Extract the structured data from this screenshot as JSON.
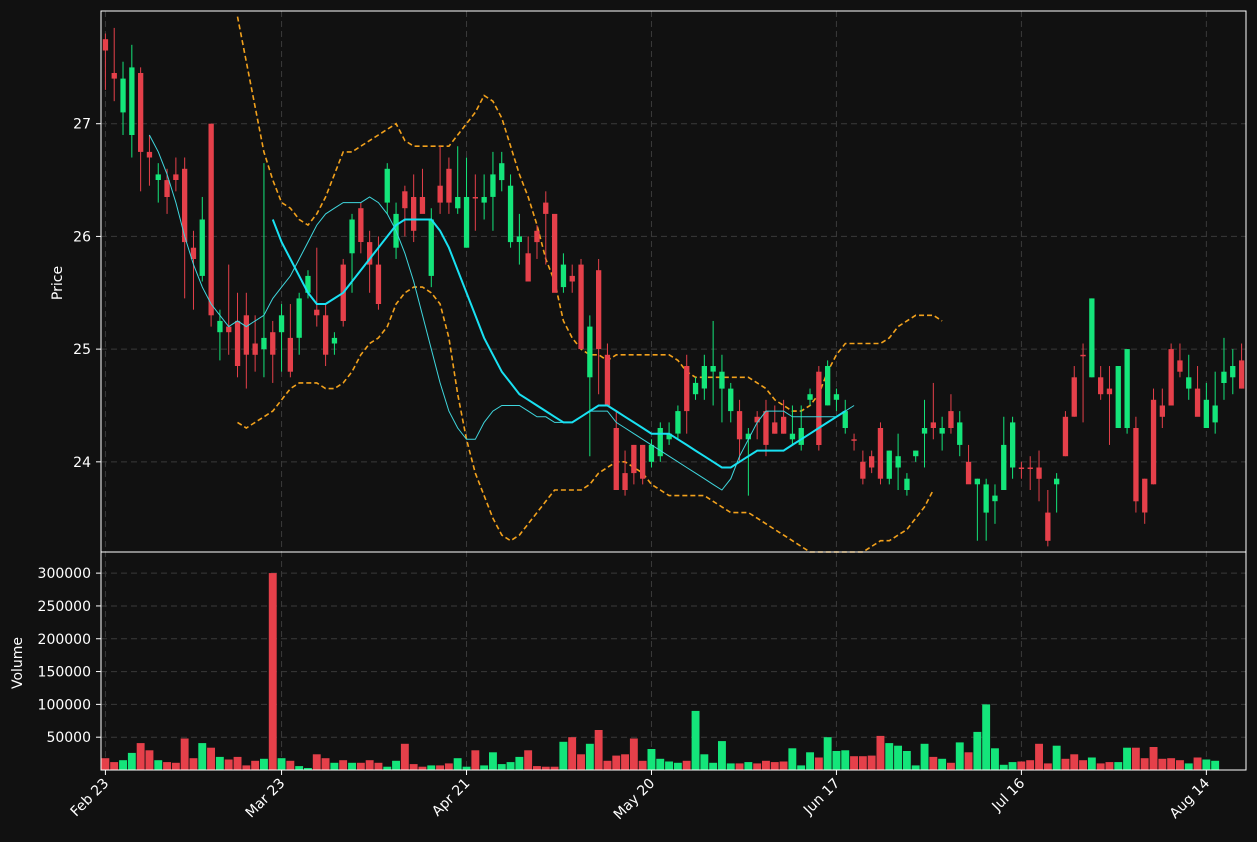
{
  "chart_data": {
    "type": "candlestick",
    "panels": [
      {
        "name": "price",
        "ylabel": "Price",
        "ylim": [
          23.2,
          28.0
        ],
        "yticks": [
          24,
          25,
          26,
          27
        ]
      },
      {
        "name": "volume",
        "ylabel": "Volume",
        "ylim": [
          0,
          320000
        ],
        "yticks": [
          50000,
          100000,
          150000,
          200000,
          250000,
          300000
        ]
      }
    ],
    "x_ticks": [
      {
        "label": "Feb 23",
        "index": 0
      },
      {
        "label": "Mar 23",
        "index": 20
      },
      {
        "label": "Apr 21",
        "index": 41
      },
      {
        "label": "May 20",
        "index": 62
      },
      {
        "label": "Jun 17",
        "index": 83
      },
      {
        "label": "Jul 16",
        "index": 104
      },
      {
        "label": "Aug 14",
        "index": 125
      }
    ],
    "colors": {
      "background": "#111111",
      "up": "#14e57a",
      "down": "#e5404a",
      "ma_fast": "#3fd6dd",
      "ma_slow": "#19e1f2",
      "band": "#f2a11c",
      "grid": "#3a3a3a",
      "axis": "#ffffff"
    },
    "up_sequence": "DDUUDDUDDDDUDUDDDDUDUDUUDDUDUDDDUUDDDUDDUUDUUUUUDDDDUDDUDDDDDDUUUUDUUUUUDUDDDDUUUDUUUDDDDUUUUUDUDUDUUUUUDDDDUDDDUDDUUDDDDDDUDUUUUDDDDUDD",
    "ohlc": [
      [
        27.65,
        27.8,
        27.3,
        27.75
      ],
      [
        27.45,
        27.85,
        27.2,
        27.4
      ],
      [
        27.1,
        27.55,
        26.9,
        27.4
      ],
      [
        26.9,
        27.7,
        26.7,
        27.5
      ],
      [
        26.75,
        27.5,
        26.4,
        27.45
      ],
      [
        26.75,
        26.9,
        26.45,
        26.7
      ],
      [
        26.5,
        26.65,
        26.3,
        26.55
      ],
      [
        26.35,
        26.6,
        26.2,
        26.5
      ],
      [
        26.5,
        26.7,
        26.4,
        26.55
      ],
      [
        25.95,
        26.7,
        25.45,
        26.6
      ],
      [
        25.8,
        26.05,
        25.35,
        25.9
      ],
      [
        26.15,
        26.35,
        25.6,
        25.65
      ],
      [
        25.3,
        27.0,
        25.2,
        27.0
      ],
      [
        25.15,
        25.35,
        24.9,
        25.25
      ],
      [
        25.15,
        25.75,
        24.95,
        25.2
      ],
      [
        25.25,
        25.5,
        24.75,
        24.85
      ],
      [
        24.95,
        25.5,
        24.65,
        25.3
      ],
      [
        25.05,
        25.3,
        24.8,
        24.95
      ],
      [
        25.1,
        26.65,
        24.75,
        25.0
      ],
      [
        24.95,
        25.25,
        24.7,
        25.15
      ],
      [
        25.15,
        25.4,
        24.8,
        25.3
      ],
      [
        24.8,
        25.4,
        24.75,
        25.1
      ],
      [
        25.1,
        25.5,
        24.95,
        25.45
      ],
      [
        25.65,
        25.7,
        25.45,
        25.5
      ],
      [
        25.3,
        25.9,
        25.2,
        25.35
      ],
      [
        25.3,
        25.4,
        24.85,
        24.95
      ],
      [
        25.05,
        25.15,
        24.95,
        25.1
      ],
      [
        25.75,
        25.8,
        25.2,
        25.25
      ],
      [
        26.15,
        26.2,
        25.5,
        25.85
      ],
      [
        25.95,
        26.3,
        25.85,
        26.25
      ],
      [
        25.75,
        26.05,
        25.5,
        25.95
      ],
      [
        25.4,
        26.0,
        25.35,
        25.75
      ],
      [
        26.3,
        26.65,
        26.2,
        26.6
      ],
      [
        25.9,
        26.3,
        25.8,
        26.2
      ],
      [
        26.25,
        26.45,
        26.0,
        26.4
      ],
      [
        26.05,
        26.55,
        25.95,
        26.35
      ],
      [
        26.35,
        26.6,
        26.25,
        26.2
      ],
      [
        25.65,
        26.25,
        25.55,
        26.15
      ],
      [
        26.3,
        26.8,
        26.2,
        26.45
      ],
      [
        26.6,
        26.7,
        26.2,
        26.3
      ],
      [
        26.25,
        26.8,
        26.2,
        26.35
      ],
      [
        25.9,
        26.7,
        25.9,
        26.35
      ],
      [
        26.35,
        26.55,
        26.05,
        26.35
      ],
      [
        26.3,
        26.55,
        26.15,
        26.35
      ],
      [
        26.55,
        26.75,
        26.05,
        26.35
      ],
      [
        26.5,
        26.75,
        26.4,
        26.65
      ],
      [
        26.45,
        26.55,
        25.9,
        25.95
      ],
      [
        26.0,
        26.2,
        25.75,
        25.95
      ],
      [
        25.85,
        26.0,
        25.65,
        25.6
      ],
      [
        26.05,
        26.1,
        25.8,
        25.95
      ],
      [
        26.3,
        26.4,
        25.75,
        26.2
      ],
      [
        26.2,
        26.1,
        25.75,
        25.5
      ],
      [
        25.75,
        25.85,
        25.5,
        25.55
      ],
      [
        25.65,
        25.75,
        25.5,
        25.6
      ],
      [
        25.75,
        25.8,
        25.0,
        25.0
      ],
      [
        25.2,
        25.3,
        24.05,
        24.75
      ],
      [
        25.7,
        25.8,
        24.6,
        25.0
      ],
      [
        24.95,
        25.05,
        24.5,
        24.5
      ],
      [
        24.3,
        24.45,
        23.75,
        23.75
      ],
      [
        23.75,
        24.1,
        23.7,
        23.9
      ],
      [
        23.9,
        24.15,
        23.8,
        24.15
      ],
      [
        23.85,
        24.15,
        23.8,
        24.15
      ],
      [
        24.15,
        24.2,
        23.95,
        24.0
      ],
      [
        24.05,
        24.35,
        24.0,
        24.3
      ],
      [
        24.2,
        24.35,
        24.15,
        24.25
      ],
      [
        24.25,
        24.5,
        24.2,
        24.45
      ],
      [
        24.45,
        24.95,
        24.25,
        24.85
      ],
      [
        24.6,
        24.75,
        24.55,
        24.7
      ],
      [
        24.65,
        24.95,
        24.55,
        24.85
      ],
      [
        24.85,
        25.25,
        24.5,
        24.8
      ],
      [
        24.8,
        24.95,
        24.35,
        24.65
      ],
      [
        24.65,
        24.7,
        24.35,
        24.45
      ],
      [
        24.45,
        24.55,
        24.0,
        24.2
      ],
      [
        24.25,
        24.3,
        23.7,
        24.2
      ],
      [
        24.35,
        24.45,
        24.2,
        24.4
      ],
      [
        24.45,
        24.55,
        24.05,
        24.15
      ],
      [
        24.35,
        24.5,
        24.25,
        24.25
      ],
      [
        24.4,
        24.55,
        24.25,
        24.25
      ],
      [
        24.25,
        24.5,
        24.15,
        24.2
      ],
      [
        24.15,
        24.5,
        24.1,
        24.3
      ],
      [
        24.55,
        24.65,
        24.5,
        24.6
      ],
      [
        24.15,
        24.85,
        24.1,
        24.8
      ],
      [
        24.85,
        24.9,
        24.5,
        24.5
      ],
      [
        24.55,
        24.65,
        24.45,
        24.6
      ],
      [
        24.45,
        24.55,
        24.25,
        24.3
      ],
      [
        24.2,
        24.25,
        24.1,
        24.2
      ],
      [
        24.0,
        24.1,
        23.8,
        23.85
      ],
      [
        23.95,
        24.1,
        23.9,
        24.05
      ],
      [
        24.3,
        24.35,
        23.8,
        23.85
      ],
      [
        23.85,
        24.1,
        23.8,
        24.1
      ],
      [
        23.95,
        24.25,
        23.75,
        24.05
      ],
      [
        23.75,
        23.9,
        23.7,
        23.85
      ],
      [
        24.05,
        24.1,
        24.0,
        24.1
      ],
      [
        24.3,
        24.55,
        23.95,
        24.25
      ],
      [
        24.35,
        24.7,
        24.2,
        24.3
      ],
      [
        24.25,
        24.4,
        24.1,
        24.3
      ],
      [
        24.45,
        24.6,
        24.25,
        24.3
      ],
      [
        24.35,
        24.45,
        24.05,
        24.15
      ],
      [
        24.0,
        24.15,
        23.85,
        23.8
      ],
      [
        23.85,
        23.85,
        23.3,
        23.8
      ],
      [
        23.8,
        23.85,
        23.3,
        23.55
      ],
      [
        23.65,
        23.8,
        23.45,
        23.7
      ],
      [
        24.15,
        24.4,
        23.8,
        23.75
      ],
      [
        24.35,
        24.4,
        23.85,
        23.95
      ],
      [
        23.95,
        24.0,
        23.85,
        23.95
      ],
      [
        23.95,
        24.05,
        23.75,
        23.95
      ],
      [
        23.95,
        24.1,
        23.65,
        23.85
      ],
      [
        23.55,
        23.75,
        23.25,
        23.3
      ],
      [
        23.8,
        23.9,
        23.55,
        23.85
      ],
      [
        24.4,
        24.45,
        24.05,
        24.05
      ],
      [
        24.75,
        24.85,
        24.4,
        24.4
      ],
      [
        24.95,
        25.05,
        24.35,
        24.95
      ],
      [
        25.45,
        25.45,
        24.75,
        24.75
      ],
      [
        24.75,
        24.85,
        24.55,
        24.6
      ],
      [
        24.65,
        24.85,
        24.15,
        24.6
      ],
      [
        24.85,
        24.85,
        24.3,
        24.3
      ],
      [
        25.0,
        25.0,
        24.25,
        24.3
      ],
      [
        24.3,
        24.4,
        23.55,
        23.65
      ],
      [
        23.55,
        23.85,
        23.45,
        23.85
      ],
      [
        24.55,
        24.65,
        23.8,
        23.8
      ],
      [
        24.4,
        24.65,
        24.3,
        24.5
      ],
      [
        24.5,
        25.05,
        24.5,
        25.0
      ],
      [
        24.9,
        25.05,
        24.75,
        24.8
      ],
      [
        24.75,
        24.95,
        24.55,
        24.65
      ],
      [
        24.65,
        24.85,
        24.45,
        24.4
      ],
      [
        24.55,
        24.7,
        24.35,
        24.3
      ],
      [
        24.5,
        24.8,
        24.25,
        24.35
      ],
      [
        24.8,
        25.1,
        24.55,
        24.7
      ],
      [
        24.75,
        25.0,
        24.6,
        24.85
      ],
      [
        24.9,
        25.05,
        24.65,
        24.65
      ]
    ],
    "volume": [
      18000,
      12000,
      15000,
      26000,
      41000,
      30000,
      15000,
      12000,
      11000,
      48000,
      18000,
      41000,
      34000,
      20000,
      16000,
      20000,
      7000,
      14000,
      17000,
      300000,
      18000,
      14000,
      6000,
      3000,
      24000,
      18000,
      11000,
      15000,
      11000,
      11000,
      15000,
      11000,
      5000,
      14000,
      40000,
      9000,
      5000,
      7000,
      7000,
      10000,
      18000,
      5000,
      30000,
      7000,
      27000,
      9000,
      12000,
      20000,
      30000,
      6000,
      5000,
      5000,
      43000,
      50000,
      24000,
      40000,
      61000,
      14000,
      22000,
      24000,
      48000,
      14000,
      32000,
      17000,
      13000,
      11000,
      14000,
      90000,
      24000,
      11000,
      44000,
      10000,
      10000,
      12000,
      10000,
      14000,
      12000,
      13000,
      33000,
      7000,
      27000,
      19000,
      50000,
      29000,
      30000,
      21000,
      21000,
      22000,
      52000,
      41000,
      37000,
      29000,
      7000,
      40000,
      20000,
      17000,
      11000,
      42000,
      27000,
      58000,
      100000,
      33000,
      8000,
      12000,
      13000,
      15000,
      40000,
      10000,
      37000,
      17000,
      24000,
      15000,
      19000,
      10000,
      12000,
      12000,
      34000,
      34000,
      18000,
      35000,
      17000,
      18000,
      15000,
      10000,
      19000,
      16000,
      14000
    ],
    "ma_fast": {
      "start": 5,
      "label": "",
      "values": [
        26.9,
        26.75,
        26.55,
        26.3,
        26.0,
        25.75,
        25.55,
        25.4,
        25.3,
        25.2,
        25.25,
        25.2,
        25.25,
        25.3,
        25.45,
        25.55,
        25.65,
        25.8,
        25.95,
        26.1,
        26.2,
        26.25,
        26.3,
        26.3,
        26.3,
        26.35,
        26.3,
        26.2,
        26.05,
        25.85,
        25.6,
        25.3,
        25.0,
        24.7,
        24.45,
        24.3,
        24.2,
        24.2,
        24.35,
        24.45,
        24.5,
        24.5,
        24.5,
        24.45,
        24.4,
        24.4,
        24.35,
        24.35,
        24.35,
        24.4,
        24.45,
        24.45,
        24.45,
        24.35,
        24.3,
        24.25,
        24.2,
        24.15,
        24.1,
        24.05,
        24.0,
        23.95,
        23.9,
        23.85,
        23.8,
        23.75,
        23.85,
        24.05,
        24.2,
        24.35,
        24.45,
        24.45,
        24.45,
        24.4,
        24.4,
        24.4,
        24.4,
        24.4,
        24.4,
        24.45,
        24.5
      ]
    },
    "ma_slow": {
      "start": 19,
      "label": "",
      "values": [
        26.15,
        25.95,
        25.8,
        25.65,
        25.5,
        25.4,
        25.4,
        25.45,
        25.5,
        25.6,
        25.7,
        25.8,
        25.9,
        26.0,
        26.1,
        26.15,
        26.15,
        26.15,
        26.15,
        26.05,
        25.9,
        25.7,
        25.5,
        25.3,
        25.1,
        24.95,
        24.8,
        24.7,
        24.6,
        24.55,
        24.5,
        24.45,
        24.4,
        24.35,
        24.35,
        24.4,
        24.45,
        24.5,
        24.5,
        24.45,
        24.4,
        24.35,
        24.3,
        24.25,
        24.25,
        24.25,
        24.2,
        24.15,
        24.1,
        24.05,
        24.0,
        23.95,
        23.95,
        24.0,
        24.05,
        24.1,
        24.1,
        24.1,
        24.1,
        24.15,
        24.2,
        24.25,
        24.3,
        24.35,
        24.4,
        24.45
      ]
    },
    "band_upper": [
      27.95,
      27.55,
      27.15,
      26.75,
      26.5,
      26.3,
      26.25,
      26.15,
      26.1,
      26.2,
      26.35,
      26.55,
      26.75,
      26.75,
      26.8,
      26.85,
      26.9,
      26.95,
      27.0,
      26.85,
      26.8,
      26.8,
      26.8,
      26.8,
      26.8,
      26.9,
      27.0,
      27.1,
      27.25,
      27.2,
      27.05,
      26.8,
      26.55,
      26.35,
      26.1,
      25.8,
      25.6,
      25.25,
      25.1,
      25.0,
      24.95,
      24.95,
      24.9,
      24.95,
      24.95,
      24.95,
      24.95,
      24.95,
      24.95,
      24.95,
      24.9,
      24.8,
      24.75,
      24.75,
      24.75,
      24.75,
      24.75,
      24.75,
      24.75,
      24.7,
      24.65,
      24.55,
      24.5,
      24.45,
      24.45,
      24.5,
      24.6,
      24.8,
      24.95,
      25.05,
      25.05,
      25.05,
      25.05,
      25.05,
      25.1,
      25.2,
      25.25,
      25.3,
      25.3,
      25.3,
      25.25
    ],
    "band_lower": [
      24.35,
      24.3,
      24.35,
      24.4,
      24.45,
      24.55,
      24.65,
      24.7,
      24.7,
      24.7,
      24.65,
      24.65,
      24.7,
      24.8,
      24.95,
      25.05,
      25.1,
      25.2,
      25.4,
      25.5,
      25.55,
      25.55,
      25.5,
      25.4,
      25.1,
      24.6,
      24.2,
      23.9,
      23.7,
      23.5,
      23.35,
      23.3,
      23.35,
      23.45,
      23.55,
      23.65,
      23.75,
      23.75,
      23.75,
      23.75,
      23.8,
      23.9,
      23.95,
      24.0,
      24.0,
      23.95,
      23.9,
      23.8,
      23.75,
      23.7,
      23.7,
      23.7,
      23.7,
      23.7,
      23.65,
      23.6,
      23.55,
      23.55,
      23.55,
      23.5,
      23.45,
      23.4,
      23.35,
      23.3,
      23.25,
      23.2,
      23.2,
      23.2,
      23.2,
      23.2,
      23.2,
      23.2,
      23.25,
      23.3,
      23.3,
      23.35,
      23.4,
      23.5,
      23.6,
      23.75
    ],
    "band_start": 15
  }
}
